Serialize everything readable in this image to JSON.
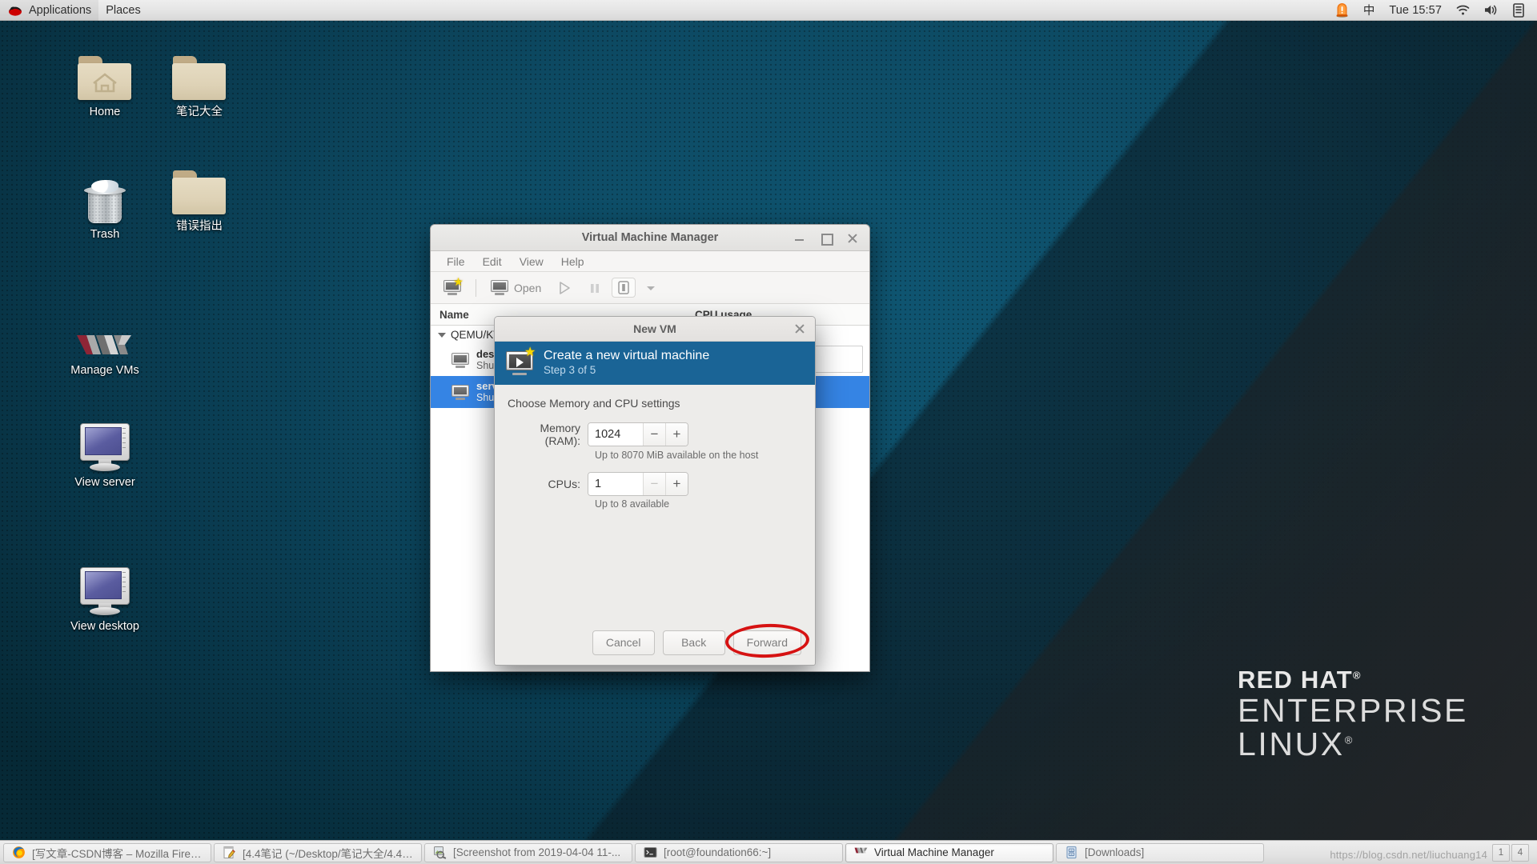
{
  "top_panel": {
    "logo_icon": "redhat-logo-icon",
    "applications_label": "Applications",
    "places_label": "Places",
    "alert_icon": "alert-siren-icon",
    "input_method_label": "中",
    "clock": "Tue 15:57",
    "wifi_icon": "wifi-icon",
    "volume_icon": "volume-icon",
    "battery_icon": "battery-icon"
  },
  "desktop": {
    "icons": [
      {
        "label": "Home",
        "icon": "home-folder-icon"
      },
      {
        "label": "笔记大全",
        "icon": "folder-icon"
      },
      {
        "label": "Trash",
        "icon": "trash-icon"
      },
      {
        "label": "错误指出",
        "icon": "folder-icon"
      },
      {
        "label": "Manage VMs",
        "icon": "vmware-vm-logo-icon"
      },
      {
        "label": "View server",
        "icon": "monitor-icon"
      },
      {
        "label": "View desktop",
        "icon": "monitor-icon"
      }
    ],
    "branding": {
      "line1": "RED HAT",
      "line2": "ENTERPRISE",
      "line3": "LINUX",
      "registered_mark": "®"
    }
  },
  "vmm_window": {
    "title": "Virtual Machine Manager",
    "window_controls": {
      "minimize": "minimize-icon",
      "maximize": "maximize-icon",
      "close": "close-icon"
    },
    "menus": [
      "File",
      "Edit",
      "View",
      "Help"
    ],
    "toolbar": {
      "new_vm_icon": "new-vm-icon",
      "open_icon": "monitor-icon",
      "open_label": "Open",
      "run_icon": "play-icon",
      "pause_icon": "pause-icon",
      "shutdown_icon": "shutdown-icon",
      "dropdown_icon": "chevron-down-icon"
    },
    "columns": [
      "Name",
      "CPU usage"
    ],
    "tree_root": "QEMU/KVM",
    "rows": [
      {
        "name": "desk",
        "state": "Shut",
        "selected": false
      },
      {
        "name": "serv",
        "state": "Shut",
        "selected": true
      }
    ]
  },
  "new_vm_dialog": {
    "title": "New VM",
    "close_icon": "close-icon",
    "banner": {
      "icon": "create-vm-icon",
      "heading": "Create a new virtual machine",
      "step": "Step 3 of 5"
    },
    "form_heading": "Choose Memory and CPU settings",
    "fields": [
      {
        "label": "Memory (RAM):",
        "value": "1024",
        "minus_label": "−",
        "plus_label": "+",
        "minus_disabled": false,
        "hint": "Up to 8070 MiB available on the host"
      },
      {
        "label": "CPUs:",
        "value": "1",
        "minus_label": "−",
        "plus_label": "+",
        "minus_disabled": true,
        "hint": "Up to 8 available"
      }
    ],
    "buttons": {
      "cancel": "Cancel",
      "back": "Back",
      "forward": "Forward"
    },
    "annotation": {
      "shape": "ellipse",
      "color": "#d61212",
      "target": "Forward"
    }
  },
  "taskbar": {
    "items": [
      {
        "label": "[写文章-CSDN博客 – Mozilla Firefox]",
        "icon": "firefox-icon",
        "active": false
      },
      {
        "label": "[4.4笔记 (~/Desktop/笔记大全/4.4) ...",
        "icon": "text-editor-icon",
        "active": false
      },
      {
        "label": "[Screenshot from 2019-04-04 11-...",
        "icon": "image-viewer-icon",
        "active": false
      },
      {
        "label": "[root@foundation66:~]",
        "icon": "terminal-icon",
        "active": false
      },
      {
        "label": "Virtual Machine Manager",
        "icon": "vmm-icon",
        "active": true
      },
      {
        "label": "[Downloads]",
        "icon": "file-manager-icon",
        "active": false
      }
    ],
    "workspaces": [
      "1",
      "4"
    ]
  },
  "watermark": "https://blog.csdn.net/liuchuang14",
  "colors": {
    "desktop_blue": "#0d4b63",
    "banner_blue": "#1a6496",
    "selection_blue": "#3584e4",
    "annotation_red": "#d61212",
    "panel_gray": "#e4e4e4"
  }
}
